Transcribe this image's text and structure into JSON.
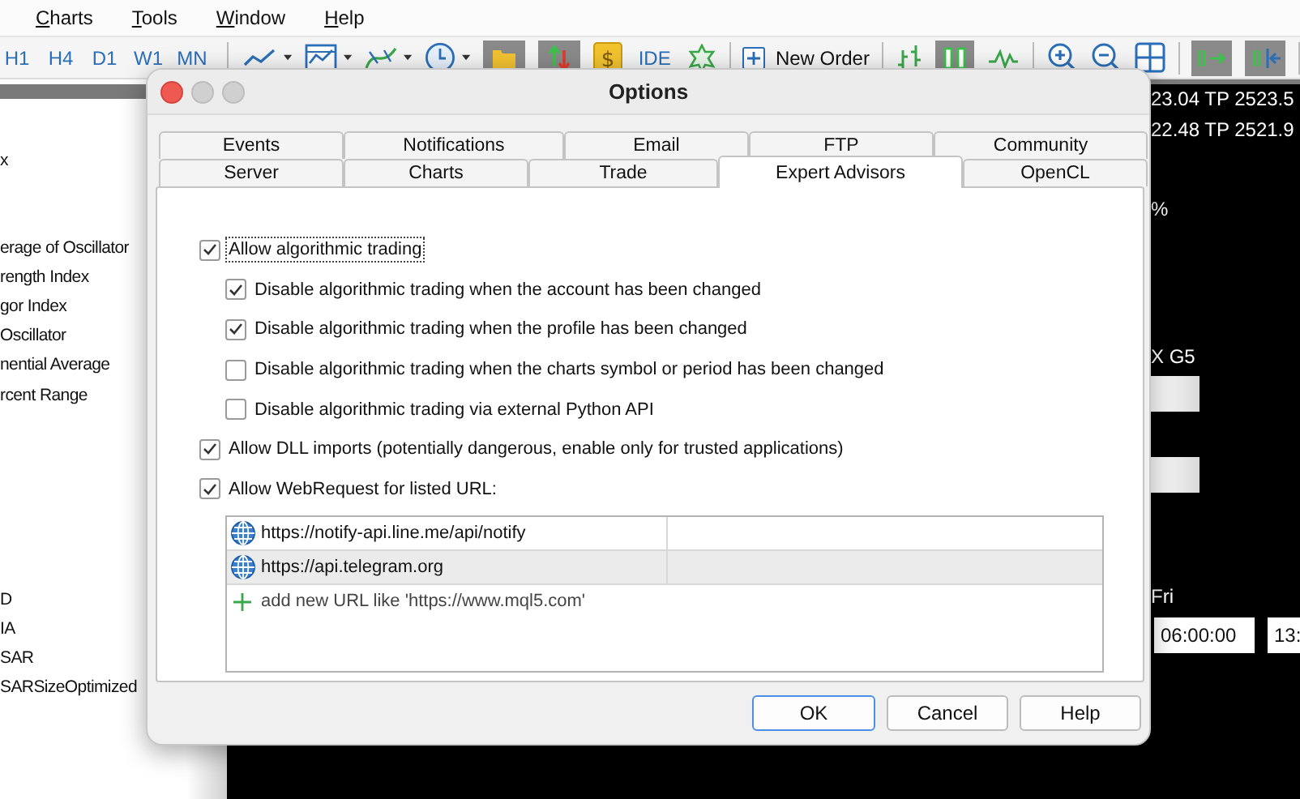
{
  "menu": [
    {
      "label": "Charts"
    },
    {
      "label": "Tools"
    },
    {
      "label": "Window"
    },
    {
      "label": "Help"
    }
  ],
  "toolbar": {
    "periods": [
      "H1",
      "H4",
      "D1",
      "W1",
      "MN"
    ],
    "currency_symbol": "$",
    "ide_label": "IDE",
    "new_order_label": "New Order"
  },
  "navigator": {
    "groups": [
      [
        "x"
      ],
      [
        "erage of Oscillator",
        "rength Index",
        "gor Index",
        "Oscillator",
        "nential Average",
        "rcent Range"
      ],
      [
        "D",
        "IA",
        "SAR",
        "SARSizeOptimized"
      ]
    ]
  },
  "chart": {
    "lines": [
      "23.04 TP 2523.5",
      "22.48 TP 2521.9"
    ],
    "percent": "%",
    "symbol": "X G5",
    "day": "Fri",
    "times": [
      "06:00:00",
      "13:"
    ]
  },
  "dialog": {
    "title": "Options",
    "tab_rows": [
      [
        {
          "label": "Events",
          "selected": false
        },
        {
          "label": "Notifications",
          "selected": false
        },
        {
          "label": "Email",
          "selected": false
        },
        {
          "label": "FTP",
          "selected": false
        },
        {
          "label": "Community",
          "selected": false
        }
      ],
      [
        {
          "label": "Server",
          "selected": false
        },
        {
          "label": "Charts",
          "selected": false
        },
        {
          "label": "Trade",
          "selected": false
        },
        {
          "label": "Expert Advisors",
          "selected": true
        },
        {
          "label": "OpenCL",
          "selected": false
        }
      ]
    ],
    "options": [
      {
        "label": "Allow algorithmic trading",
        "checked": true,
        "focused": true,
        "children": [
          {
            "label": "Disable algorithmic trading when the account has been changed",
            "checked": true
          },
          {
            "label": "Disable algorithmic trading when the profile has been changed",
            "checked": true
          },
          {
            "label": "Disable algorithmic trading when the charts symbol or period has been changed",
            "checked": false
          },
          {
            "label": "Disable algorithmic trading via external Python API",
            "checked": false
          }
        ]
      },
      {
        "label": "Allow DLL imports (potentially dangerous, enable only for trusted applications)",
        "checked": true
      },
      {
        "label": "Allow WebRequest for listed URL:",
        "checked": true
      }
    ],
    "urls": [
      {
        "url": "https://notify-api.line.me/api/notify",
        "selected": false
      },
      {
        "url": "https://api.telegram.org",
        "selected": true
      }
    ],
    "add_hint": "add new URL like 'https://www.mql5.com'",
    "buttons": [
      {
        "label": "OK",
        "default": true
      },
      {
        "label": "Cancel",
        "default": false
      },
      {
        "label": "Help",
        "default": false
      }
    ]
  }
}
